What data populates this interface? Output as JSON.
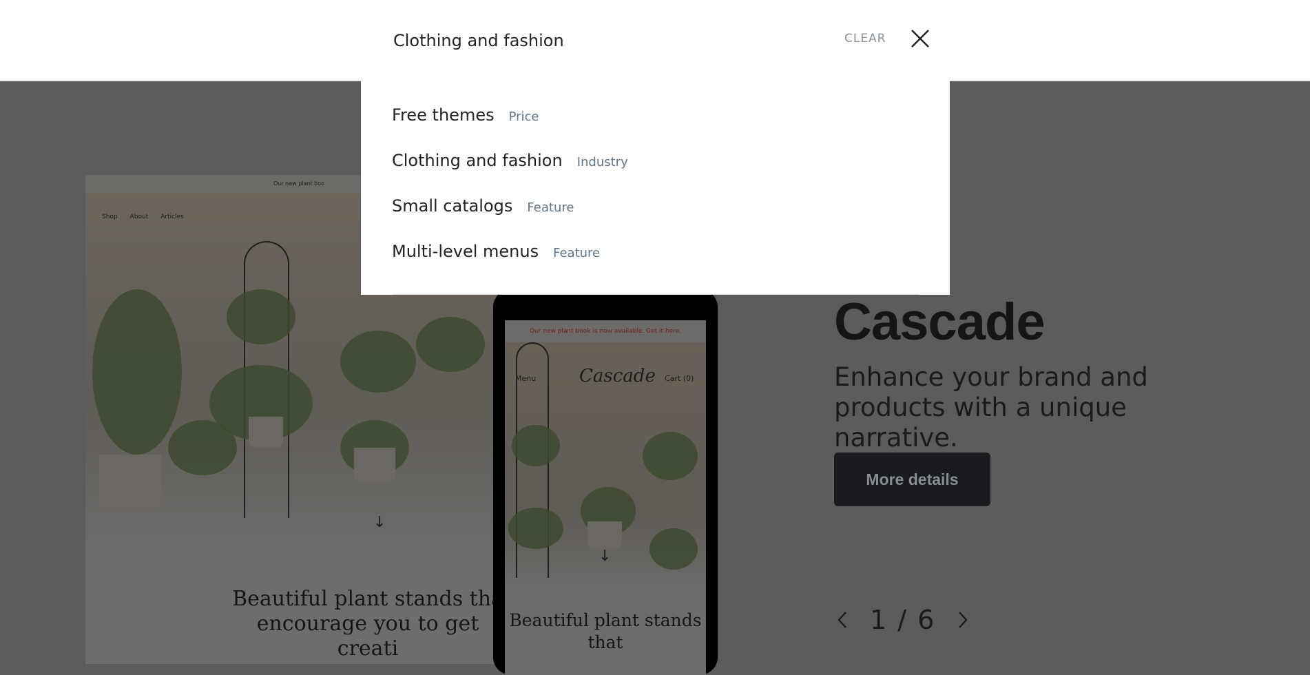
{
  "search": {
    "value": "Clothing and fashion",
    "clear_label": "CLEAR"
  },
  "suggestions": [
    {
      "label": "Free themes",
      "tag": "Price"
    },
    {
      "label": "Clothing and fashion",
      "tag": "Industry"
    },
    {
      "label": "Small catalogs",
      "tag": "Feature"
    },
    {
      "label": "Multi-level menus",
      "tag": "Feature"
    }
  ],
  "preview": {
    "desktop_banner": "Our new plant boo",
    "desktop_nav": [
      "Shop",
      "About",
      "Articles"
    ],
    "desktop_headline": "Beautiful plant stands tha encourage you to get creati",
    "phone_banner": "Our new plant book is now available. Get it here.",
    "phone_menu": "Menu",
    "phone_logo": "Cascade",
    "phone_cart": "Cart (0)",
    "phone_headline": "Beautiful plant stands that"
  },
  "theme": {
    "name": "Cascade",
    "description": "Enhance your brand and products with a unique narrative.",
    "details_button": "More details",
    "pager": "1 / 6"
  },
  "icons": {
    "close": "close-icon",
    "prev": "chevron-left-icon",
    "next": "chevron-right-icon",
    "scroll": "arrow-down-icon"
  }
}
